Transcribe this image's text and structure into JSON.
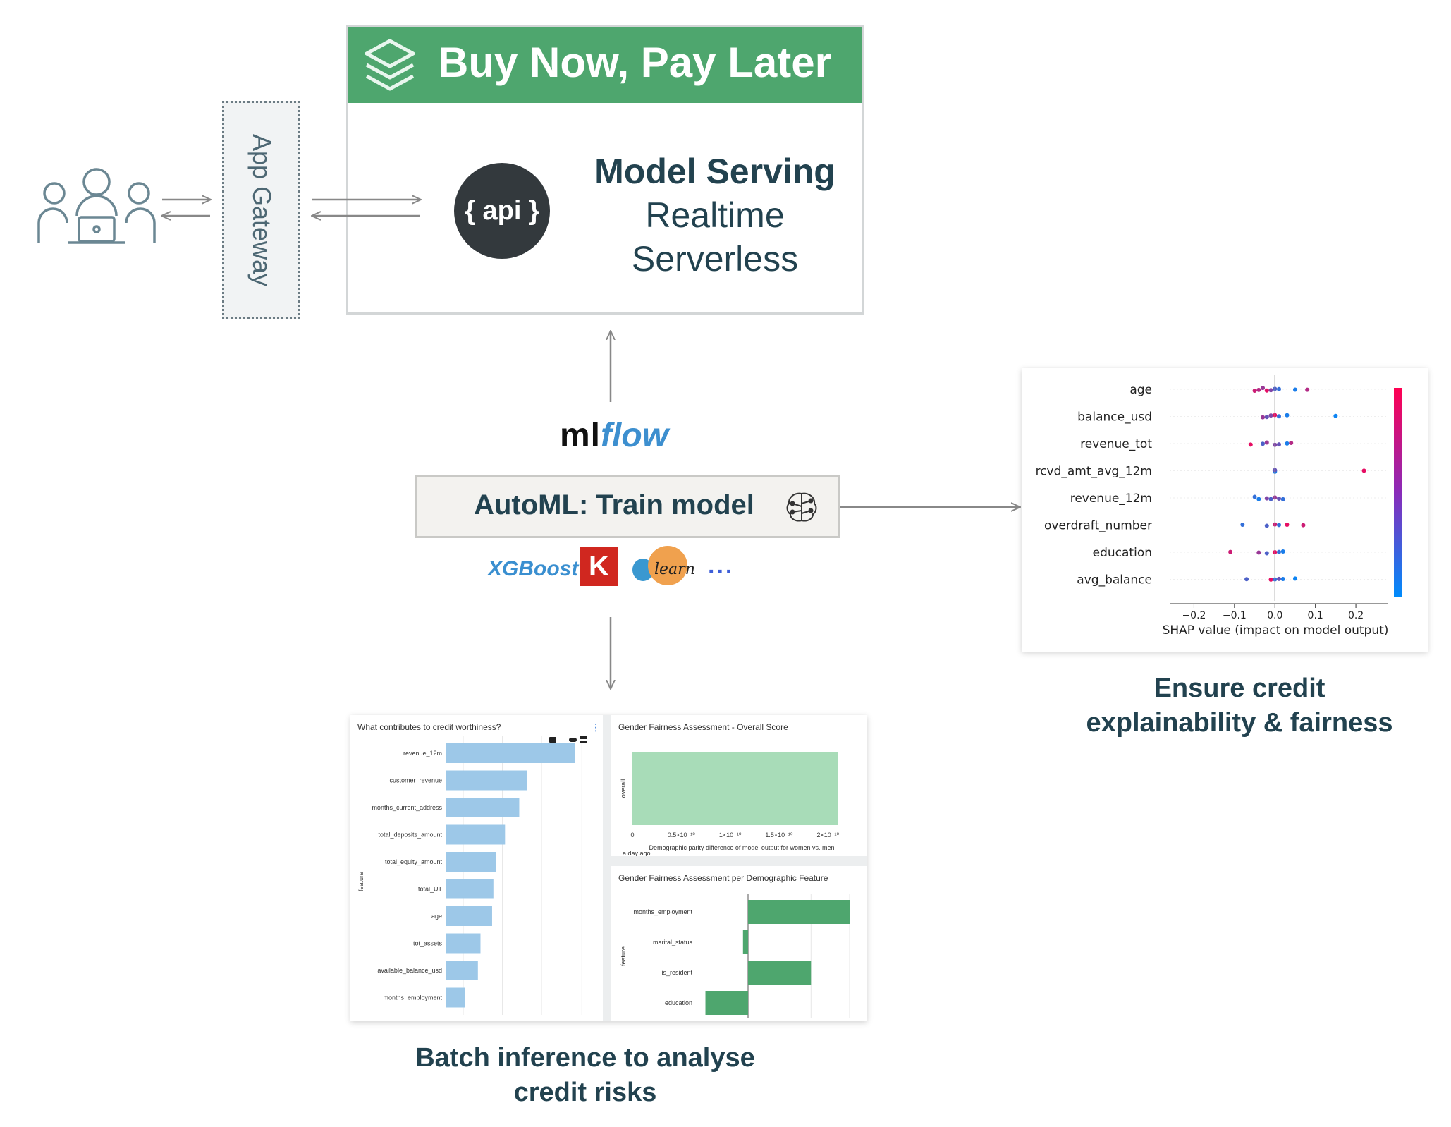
{
  "gateway": {
    "label": "App Gateway"
  },
  "bnpl": {
    "title": "Buy Now, Pay Later",
    "api_label": "{ api }",
    "serving_title": "Model Serving",
    "serving_line1": "Realtime",
    "serving_line2": "Serverless"
  },
  "mlflow": {
    "ml": "ml",
    "flow": "flow"
  },
  "automl": {
    "label": "AutoML: Train model"
  },
  "libraries": {
    "xgboost": "XGBoost",
    "keras": "K",
    "sklearn": "learn",
    "more": "..."
  },
  "shap": {
    "caption_line1": "Ensure credit",
    "caption_line2": "explainability & fairness",
    "xlabel": "SHAP value (impact on model output)",
    "features": [
      "age",
      "balance_usd",
      "revenue_tot",
      "rcvd_amt_avg_12m",
      "revenue_12m",
      "overdraft_number",
      "education",
      "avg_balance"
    ],
    "ticks": [
      "−0.2",
      "−0.1",
      "0.0",
      "0.1",
      "0.2"
    ],
    "colors": {
      "high": "#ff0052",
      "low": "#008bfb"
    }
  },
  "dashboard": {
    "caption_line1": "Batch inference to analyse",
    "caption_line2": "credit risks",
    "contrib_title": "What contributes to credit worthiness?",
    "contrib_ylabel": "feature",
    "overall_title": "Gender Fairness Assessment - Overall Score",
    "overall_ylabel": "overall",
    "overall_xlabel": "Demographic parity difference of model output for women vs. men",
    "overall_ticks": [
      "0",
      "0.5×10⁻¹⁰",
      "1×10⁻¹⁰",
      "1.5×10⁻¹⁰",
      "2×10⁻¹⁰"
    ],
    "overall_timestamp": "a day ago",
    "perfeat_title": "Gender Fairness Assessment per Demographic Feature",
    "perfeat_ylabel": "feature"
  },
  "chart_data": [
    {
      "type": "bar",
      "orientation": "horizontal",
      "title": "What contributes to credit worthiness?",
      "ylabel": "feature",
      "categories": [
        "revenue_12m",
        "customer_revenue",
        "months_current_address",
        "total_deposits_amount",
        "total_equity_amount",
        "total_UT",
        "age",
        "tot_assets",
        "available_balance_usd",
        "months_employment"
      ],
      "values": [
        1.0,
        0.63,
        0.57,
        0.46,
        0.39,
        0.37,
        0.36,
        0.27,
        0.25,
        0.15
      ],
      "color": "#9dc8e8"
    },
    {
      "type": "bar",
      "orientation": "horizontal",
      "title": "Gender Fairness Assessment - Overall Score",
      "xlabel": "Demographic parity difference of model output for women vs. men",
      "ylabel": "overall",
      "categories": [
        "overall"
      ],
      "values": [
        2.1e-10
      ],
      "xlim": [
        0,
        2.2e-10
      ],
      "color": "#a8dcb8"
    },
    {
      "type": "bar",
      "orientation": "horizontal",
      "title": "Gender Fairness Assessment per Demographic Feature",
      "ylabel": "feature",
      "categories": [
        "months_employment",
        "marital_status",
        "is_resident",
        "education"
      ],
      "values": [
        1.0,
        -0.05,
        0.62,
        -0.42
      ],
      "color": "#4ea66e"
    },
    {
      "type": "scatter",
      "title": "",
      "xlabel": "SHAP value (impact on model output)",
      "xlim": [
        -0.26,
        0.28
      ],
      "features": [
        "age",
        "balance_usd",
        "revenue_tot",
        "rcvd_amt_avg_12m",
        "revenue_12m",
        "overdraft_number",
        "education",
        "avg_balance"
      ],
      "points": [
        [
          [
            -0.05,
            0.8
          ],
          [
            -0.04,
            0.7
          ],
          [
            -0.03,
            0.6
          ],
          [
            -0.02,
            0.9
          ],
          [
            -0.01,
            0.5
          ],
          [
            0.0,
            0.3
          ],
          [
            0.01,
            0.2
          ],
          [
            0.05,
            0.1
          ],
          [
            0.08,
            0.7
          ]
        ],
        [
          [
            -0.03,
            0.6
          ],
          [
            -0.02,
            0.4
          ],
          [
            -0.01,
            0.5
          ],
          [
            0.0,
            0.9
          ],
          [
            0.01,
            0.2
          ],
          [
            0.03,
            0.1
          ],
          [
            0.15,
            0.05
          ]
        ],
        [
          [
            -0.06,
            0.9
          ],
          [
            -0.03,
            0.3
          ],
          [
            -0.02,
            0.6
          ],
          [
            0.0,
            0.5
          ],
          [
            0.01,
            0.4
          ],
          [
            0.03,
            0.1
          ],
          [
            0.04,
            0.7
          ]
        ],
        [
          [
            0.0,
            0.2
          ],
          [
            0.0,
            0.3
          ],
          [
            0.0,
            0.1
          ],
          [
            0.0,
            0.4
          ],
          [
            0.22,
            0.9
          ]
        ],
        [
          [
            -0.05,
            0.2
          ],
          [
            -0.04,
            0.1
          ],
          [
            -0.02,
            0.5
          ],
          [
            -0.01,
            0.3
          ],
          [
            0.0,
            0.6
          ],
          [
            0.01,
            0.4
          ],
          [
            0.02,
            0.2
          ]
        ],
        [
          [
            -0.08,
            0.2
          ],
          [
            -0.02,
            0.3
          ],
          [
            0.0,
            0.8
          ],
          [
            0.01,
            0.2
          ],
          [
            0.03,
            0.9
          ],
          [
            0.07,
            0.8
          ]
        ],
        [
          [
            -0.11,
            0.8
          ],
          [
            -0.04,
            0.6
          ],
          [
            -0.02,
            0.3
          ],
          [
            0.0,
            0.9
          ],
          [
            0.01,
            0.2
          ],
          [
            0.02,
            0.1
          ]
        ],
        [
          [
            -0.07,
            0.3
          ],
          [
            -0.01,
            0.9
          ],
          [
            0.0,
            0.2
          ],
          [
            0.01,
            0.4
          ],
          [
            0.02,
            0.1
          ],
          [
            0.05,
            0.05
          ]
        ]
      ]
    }
  ]
}
